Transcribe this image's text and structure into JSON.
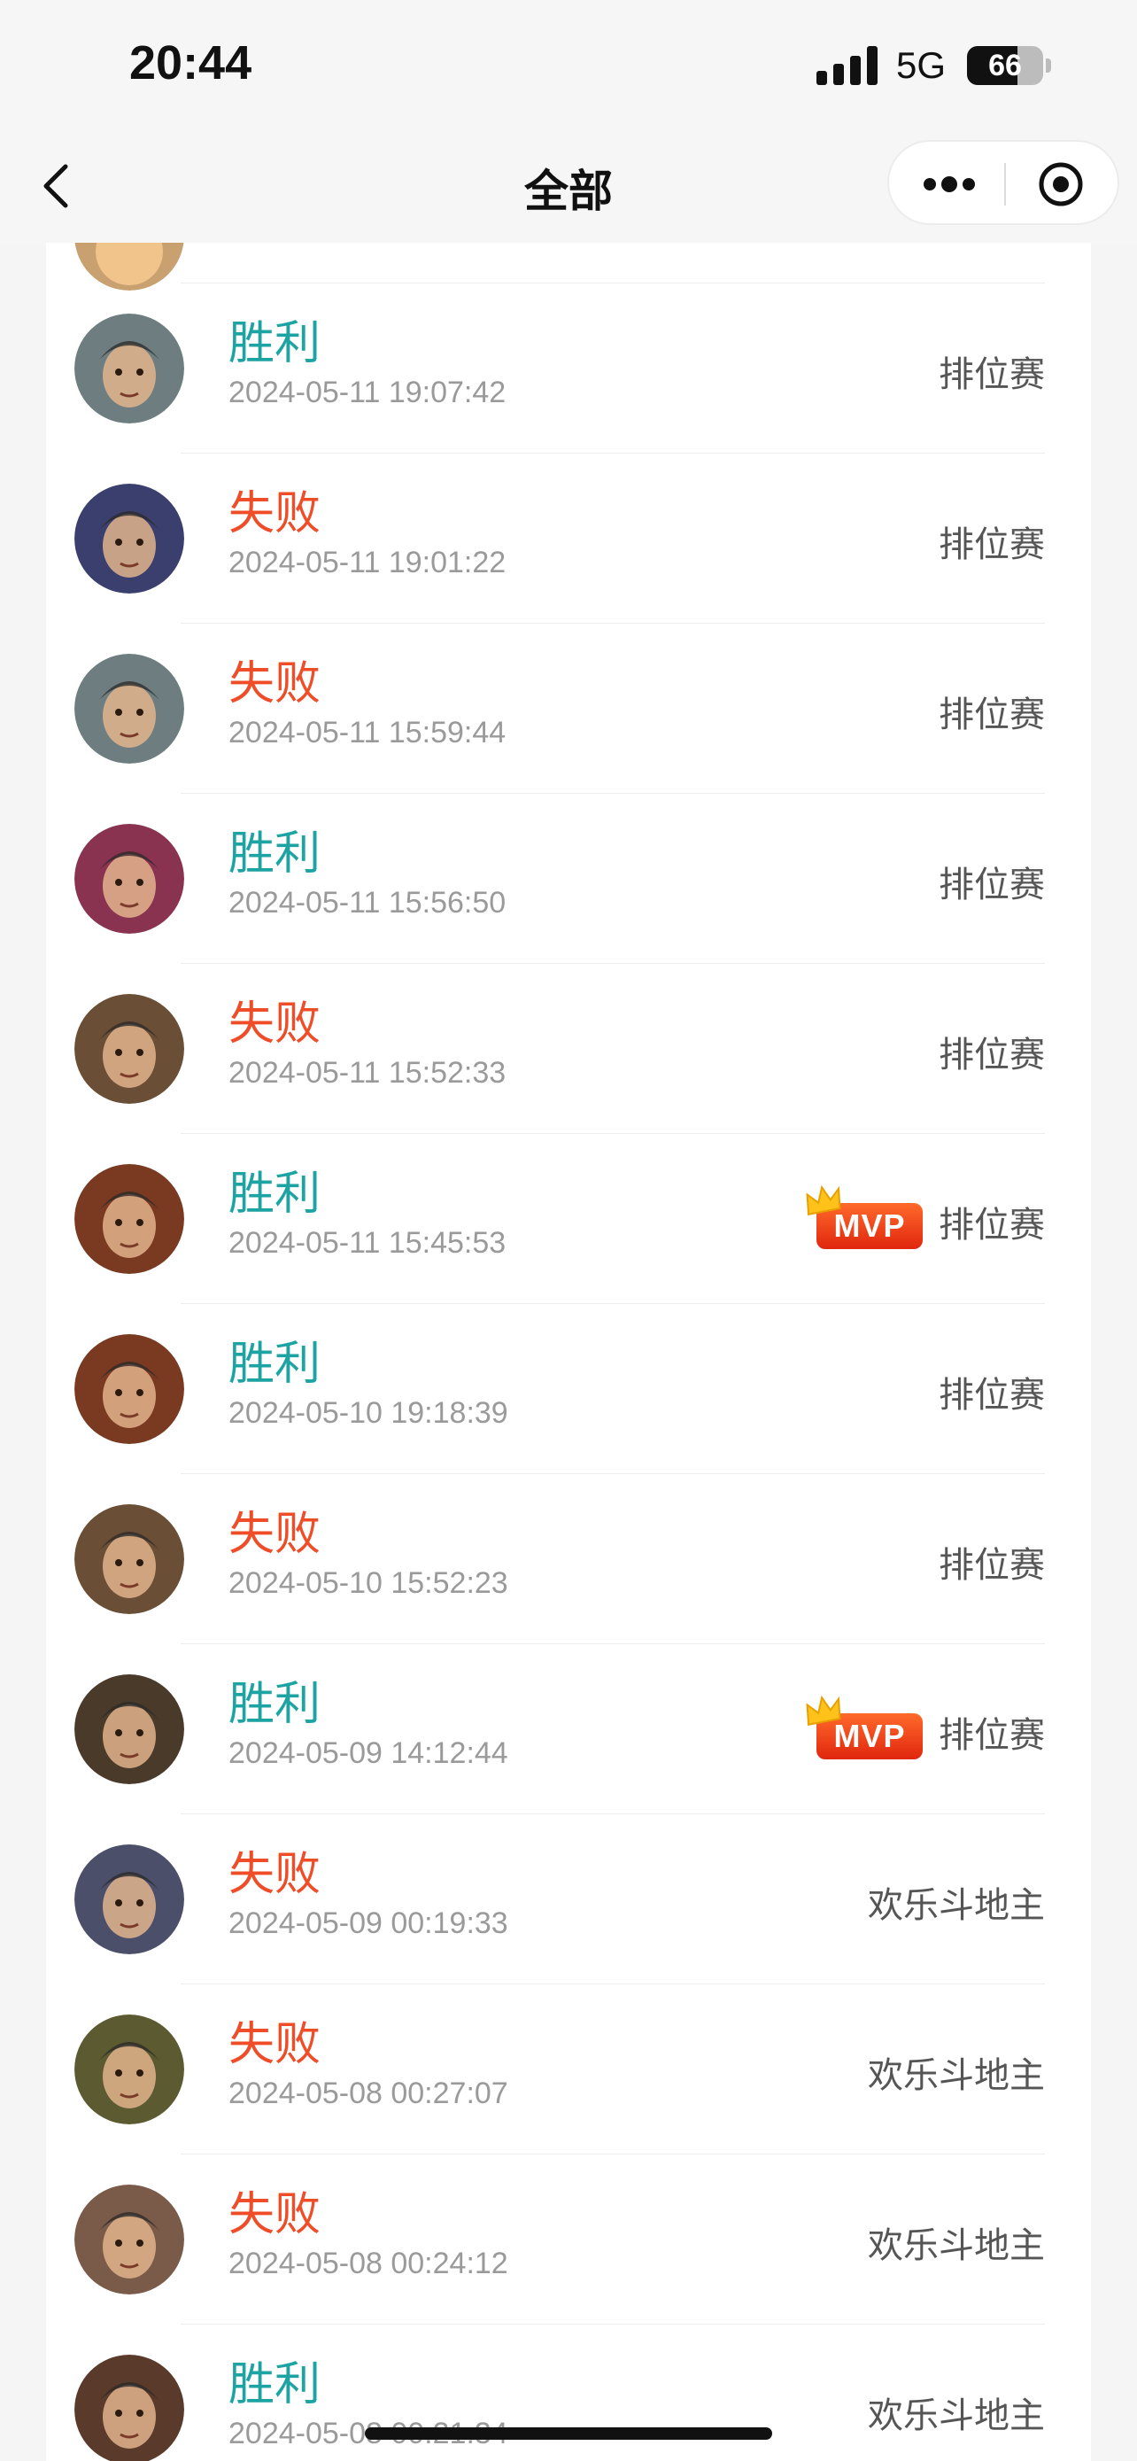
{
  "status_bar": {
    "time": "20:44",
    "network": "5G",
    "battery": "66",
    "battery_level": 0.66
  },
  "nav": {
    "title": "全部"
  },
  "records": [
    {
      "result": "胜利",
      "outcome": "win",
      "timestamp": "2024-05-11 19:07:42",
      "mode": "排位赛",
      "mvp": false,
      "hero_color": "#6e7e80"
    },
    {
      "result": "失败",
      "outcome": "lose",
      "timestamp": "2024-05-11 19:01:22",
      "mode": "排位赛",
      "mvp": false,
      "hero_color": "#3a3f6e"
    },
    {
      "result": "失败",
      "outcome": "lose",
      "timestamp": "2024-05-11 15:59:44",
      "mode": "排位赛",
      "mvp": false,
      "hero_color": "#6e7e80"
    },
    {
      "result": "胜利",
      "outcome": "win",
      "timestamp": "2024-05-11 15:56:50",
      "mode": "排位赛",
      "mvp": false,
      "hero_color": "#8a3350"
    },
    {
      "result": "失败",
      "outcome": "lose",
      "timestamp": "2024-05-11 15:52:33",
      "mode": "排位赛",
      "mvp": false,
      "hero_color": "#6b4e36"
    },
    {
      "result": "胜利",
      "outcome": "win",
      "timestamp": "2024-05-11 15:45:53",
      "mode": "排位赛",
      "mvp": true,
      "hero_color": "#7a3a22"
    },
    {
      "result": "胜利",
      "outcome": "win",
      "timestamp": "2024-05-10 19:18:39",
      "mode": "排位赛",
      "mvp": false,
      "hero_color": "#7a3a22"
    },
    {
      "result": "失败",
      "outcome": "lose",
      "timestamp": "2024-05-10 15:52:23",
      "mode": "排位赛",
      "mvp": false,
      "hero_color": "#6b4e36"
    },
    {
      "result": "胜利",
      "outcome": "win",
      "timestamp": "2024-05-09 14:12:44",
      "mode": "排位赛",
      "mvp": true,
      "hero_color": "#4a3a2a"
    },
    {
      "result": "失败",
      "outcome": "lose",
      "timestamp": "2024-05-09 00:19:33",
      "mode": "欢乐斗地主",
      "mvp": false,
      "hero_color": "#4b4f6a"
    },
    {
      "result": "失败",
      "outcome": "lose",
      "timestamp": "2024-05-08 00:27:07",
      "mode": "欢乐斗地主",
      "mvp": false,
      "hero_color": "#5b5a30"
    },
    {
      "result": "失败",
      "outcome": "lose",
      "timestamp": "2024-05-08 00:24:12",
      "mode": "欢乐斗地主",
      "mvp": false,
      "hero_color": "#7a5a48"
    },
    {
      "result": "胜利",
      "outcome": "win",
      "timestamp": "2024-05-08 00:21:34",
      "mode": "欢乐斗地主",
      "mvp": false,
      "hero_color": "#5a3a2a"
    }
  ],
  "mvp_label": "MVP"
}
